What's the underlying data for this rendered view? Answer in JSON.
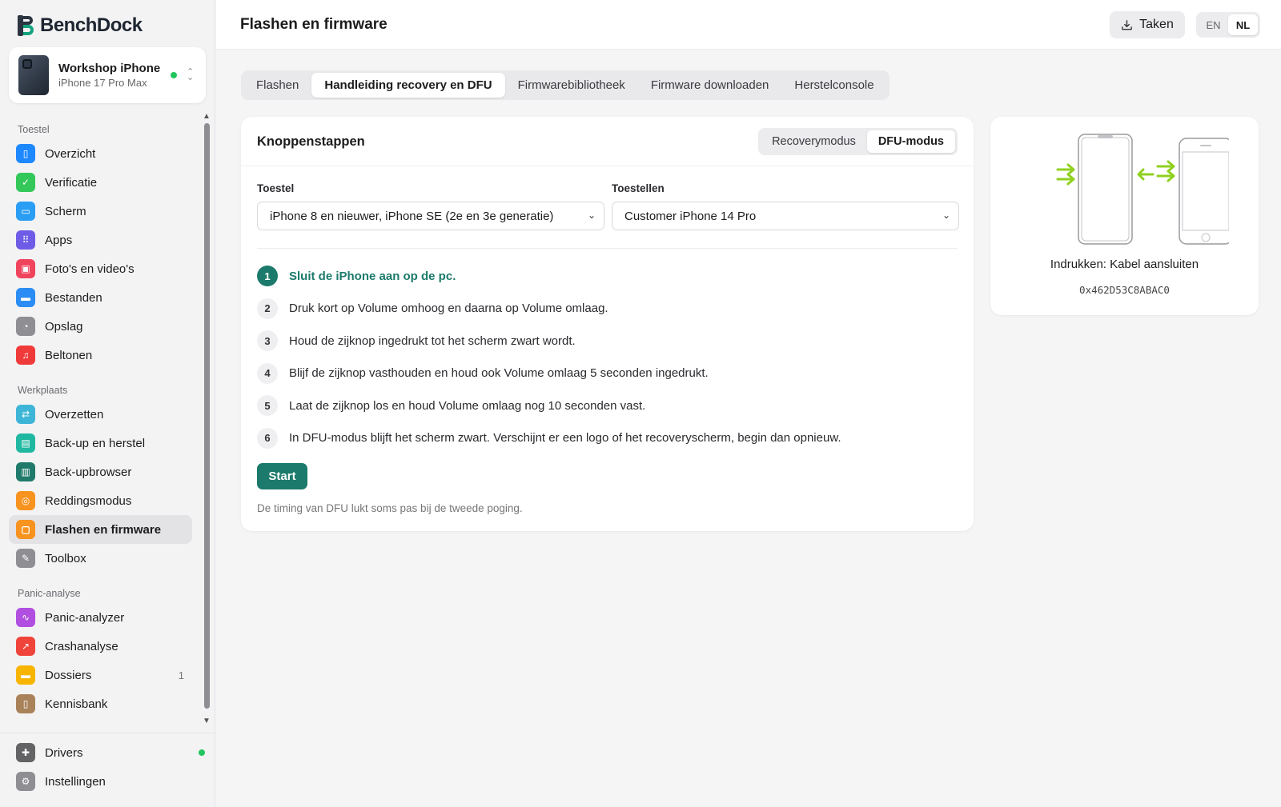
{
  "app": {
    "name_part1": "Bench",
    "name_part2": "Dock"
  },
  "device": {
    "name": "Workshop iPhone",
    "model": "iPhone 17 Pro Max"
  },
  "sidebar": {
    "sections": [
      {
        "title": "Toestel",
        "items": [
          {
            "label": "Overzicht",
            "icon": "phone-icon",
            "color": "#1e88ff"
          },
          {
            "label": "Verificatie",
            "icon": "shield-check-icon",
            "color": "#34c759"
          },
          {
            "label": "Scherm",
            "icon": "screen-icon",
            "color": "#2a9df4"
          },
          {
            "label": "Apps",
            "icon": "apps-grid-icon",
            "color": "#6e5ce6"
          },
          {
            "label": "Foto's en video's",
            "icon": "photos-icon",
            "color": "#f0445c"
          },
          {
            "label": "Bestanden",
            "icon": "folder-icon",
            "color": "#2a8cf4"
          },
          {
            "label": "Opslag",
            "icon": "pie-chart-icon",
            "color": "#8e8e93"
          },
          {
            "label": "Beltonen",
            "icon": "music-note-icon",
            "color": "#f03a3a"
          }
        ]
      },
      {
        "title": "Werkplaats",
        "items": [
          {
            "label": "Overzetten",
            "icon": "transfer-arrows-icon",
            "color": "#3db5d6"
          },
          {
            "label": "Back-up en herstel",
            "icon": "backup-box-icon",
            "color": "#20b8a0"
          },
          {
            "label": "Back-upbrowser",
            "icon": "archive-icon",
            "color": "#1f7a6b"
          },
          {
            "label": "Reddingsmodus",
            "icon": "lifebuoy-icon",
            "color": "#f7931e"
          },
          {
            "label": "Flashen en firmware",
            "icon": "chip-icon",
            "color": "#f7931e",
            "active": true
          },
          {
            "label": "Toolbox",
            "icon": "wrench-icon",
            "color": "#8e8e93"
          }
        ]
      },
      {
        "title": "Panic-analyse",
        "items": [
          {
            "label": "Panic-analyzer",
            "icon": "waveform-icon",
            "color": "#b04fe0"
          },
          {
            "label": "Crashanalyse",
            "icon": "chart-line-icon",
            "color": "#f0443a"
          },
          {
            "label": "Dossiers",
            "icon": "folder-icon",
            "color": "#f7b500",
            "badge": "1"
          },
          {
            "label": "Kennisbank",
            "icon": "book-icon",
            "color": "#a9825a"
          }
        ]
      }
    ],
    "bottom": [
      {
        "label": "Drivers",
        "icon": "puzzle-icon",
        "color": "#636366"
      },
      {
        "label": "Instellingen",
        "icon": "gear-icon",
        "color": "#8e8e93"
      }
    ]
  },
  "header": {
    "title": "Flashen en firmware",
    "tasks_label": "Taken",
    "lang_en": "EN",
    "lang_nl": "NL"
  },
  "tabs": [
    {
      "label": "Flashen"
    },
    {
      "label": "Handleiding recovery en DFU",
      "active": true
    },
    {
      "label": "Firmwarebibliotheek"
    },
    {
      "label": "Firmware downloaden"
    },
    {
      "label": "Herstelconsole"
    }
  ],
  "card": {
    "title": "Knoppenstappen",
    "mode_recovery": "Recoverymodus",
    "mode_dfu": "DFU-modus",
    "label_device": "Toestel",
    "label_devices": "Toestellen",
    "select_device": "iPhone 8 en nieuwer, iPhone SE (2e en 3e generatie)",
    "select_devices": "Customer iPhone 14 Pro",
    "steps": [
      {
        "num": "1",
        "text": "Sluit de iPhone aan op de pc."
      },
      {
        "num": "2",
        "text": "Druk kort op Volume omhoog en daarna op Volume omlaag."
      },
      {
        "num": "3",
        "text": "Houd de zijknop ingedrukt tot het scherm zwart wordt."
      },
      {
        "num": "4",
        "text": "Blijf de zijknop vasthouden en houd ook Volume omlaag 5 seconden ingedrukt."
      },
      {
        "num": "5",
        "text": "Laat de zijknop los en houd Volume omlaag nog 10 seconden vast."
      },
      {
        "num": "6",
        "text": "In DFU-modus blijft het scherm zwart. Verschijnt er een logo of het recoveryscherm, begin dan opnieuw."
      }
    ],
    "start_label": "Start",
    "hint": "De timing van DFU lukt soms pas bij de tweede poging."
  },
  "illustration": {
    "caption": "Indrukken: Kabel aansluiten",
    "code": "0x462D53C8ABAC0"
  },
  "colors": {
    "accent": "#1b7a6b",
    "arrow": "#8fd11f",
    "status_green": "#22c55e"
  }
}
